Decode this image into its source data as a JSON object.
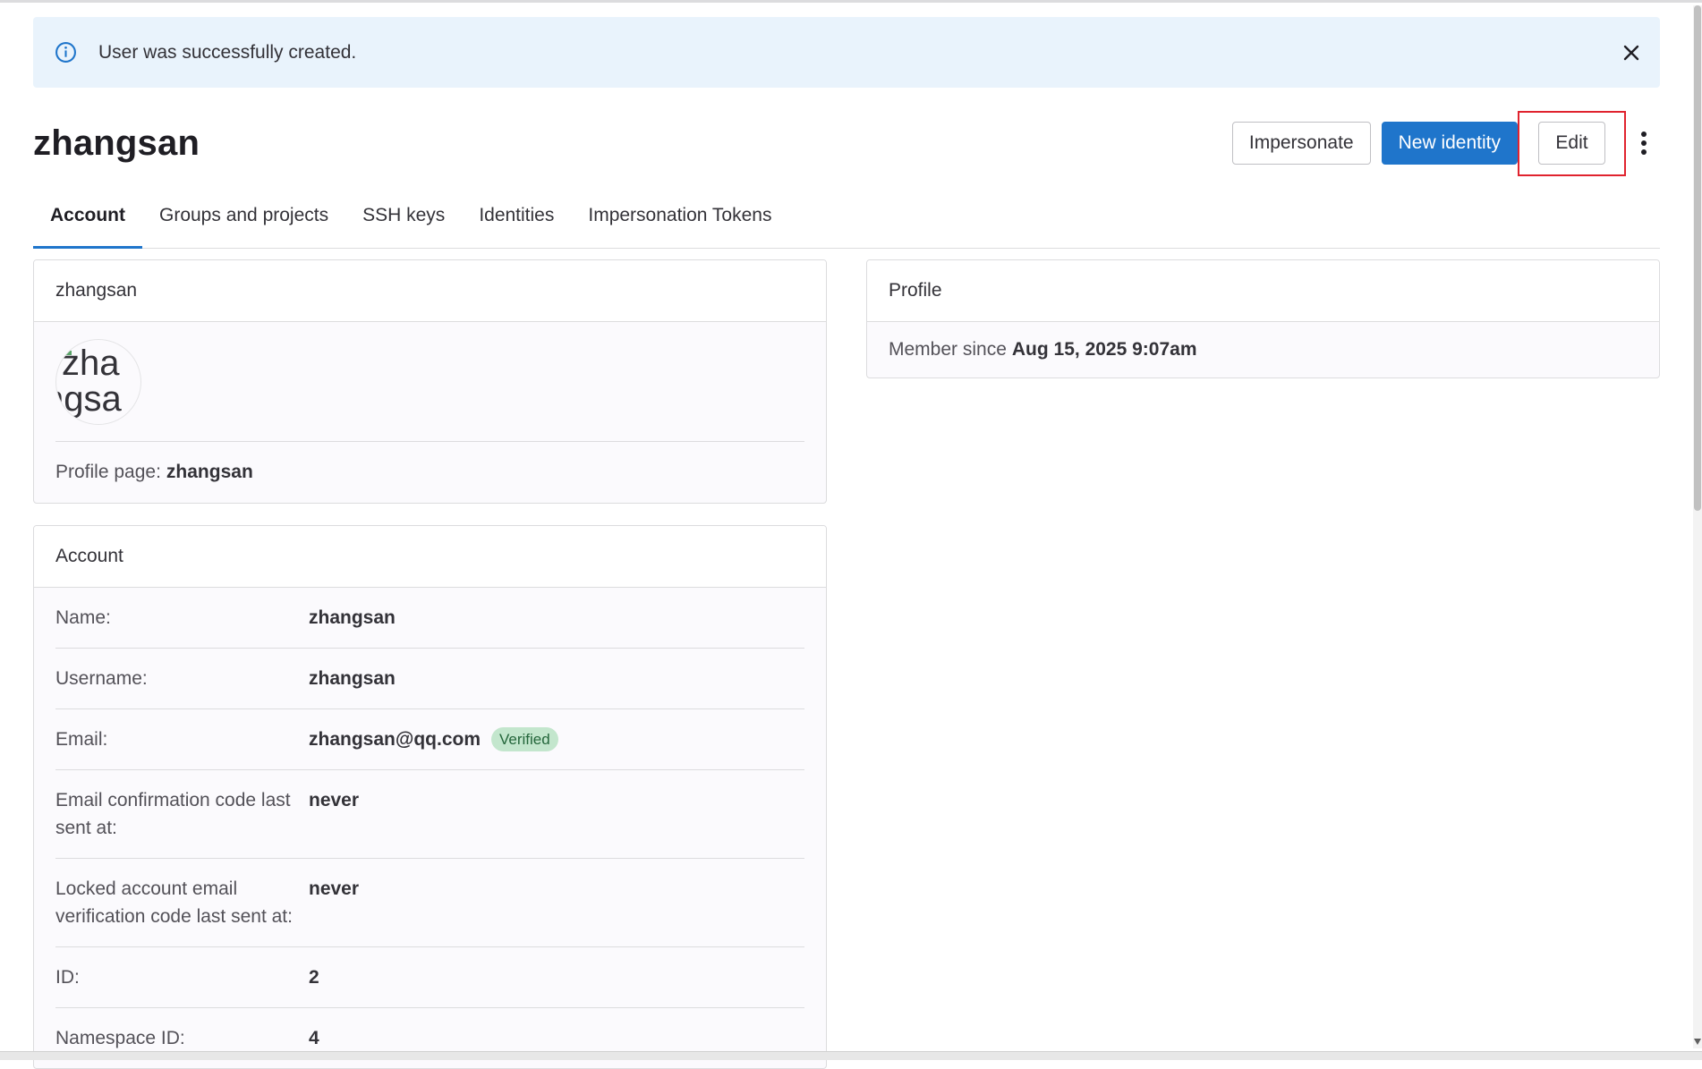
{
  "alert": {
    "message": "User was successfully created.",
    "icon": "info-circle-icon",
    "close_icon": "close-icon",
    "background": "#e9f3fc"
  },
  "header": {
    "title": "zhangsan",
    "impersonate_label": "Impersonate",
    "new_identity_label": "New identity",
    "edit_label": "Edit",
    "more_icon": "kebab-vertical-icon",
    "primary_color": "#1f75cb",
    "highlight_color": "#e0232e"
  },
  "tabs": [
    {
      "label": "Account",
      "active": true
    },
    {
      "label": "Groups and projects",
      "active": false
    },
    {
      "label": "SSH keys",
      "active": false
    },
    {
      "label": "Identities",
      "active": false
    },
    {
      "label": "Impersonation Tokens",
      "active": false
    }
  ],
  "user_card": {
    "title": "zhangsan",
    "avatar_alt_line1": "zha",
    "avatar_alt_line2": "ngsa",
    "profile_page_label": "Profile page:",
    "profile_page_value": "zhangsan"
  },
  "profile_card": {
    "title": "Profile",
    "member_since_label": "Member since",
    "member_since_value": "Aug 15, 2025 9:07am"
  },
  "account_card": {
    "title": "Account",
    "rows": [
      {
        "label": "Name:",
        "value": "zhangsan"
      },
      {
        "label": "Username:",
        "value": "zhangsan"
      },
      {
        "label": "Email:",
        "value": "zhangsan@qq.com",
        "badge": "Verified"
      },
      {
        "label": "Email confirmation code last sent at:",
        "value": "never"
      },
      {
        "label": "Locked account email verification code last sent at:",
        "value": "never"
      },
      {
        "label": "ID:",
        "value": "2"
      },
      {
        "label": "Namespace ID:",
        "value": "4"
      }
    ]
  }
}
